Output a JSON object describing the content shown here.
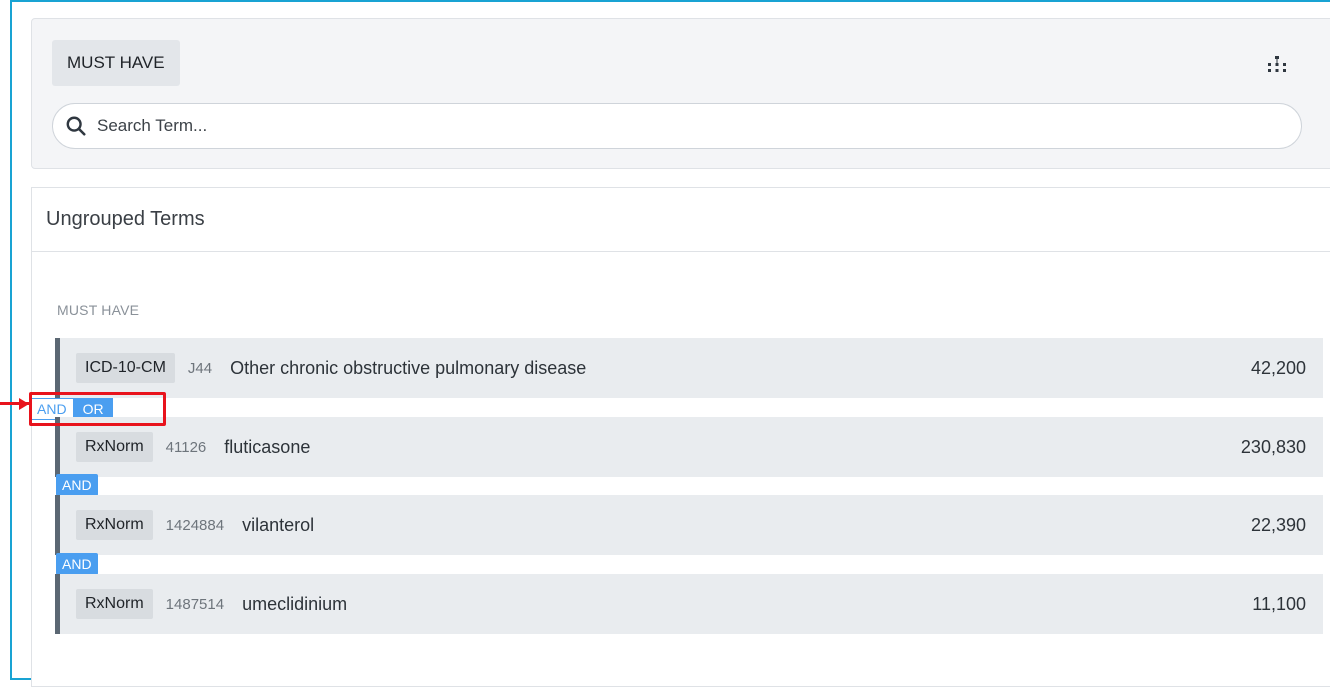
{
  "search_panel": {
    "must_have_label": "MUST HAVE",
    "search_placeholder": "Search Term..."
  },
  "terms_panel": {
    "header": "Ungrouped Terms",
    "section_label": "MUST HAVE",
    "terms": [
      {
        "vocab": "ICD-10-CM",
        "code": "J44",
        "name": "Other chronic obstructive pulmonary disease",
        "count": "42,200"
      },
      {
        "vocab": "RxNorm",
        "code": "41126",
        "name": "fluticasone",
        "count": "230,830"
      },
      {
        "vocab": "RxNorm",
        "code": "1424884",
        "name": "vilanterol",
        "count": "22,390"
      },
      {
        "vocab": "RxNorm",
        "code": "1487514",
        "name": "umeclidinium",
        "count": "11,100"
      }
    ],
    "operators": {
      "toggle_and": "AND",
      "toggle_or": "OR",
      "and_2": "AND",
      "and_3": "AND"
    }
  },
  "colors": {
    "accent": "#4a9ef0",
    "highlight": "#e8131c",
    "frame": "#19a3d3"
  },
  "icons": [
    "tree-hierarchy-icon",
    "search-icon"
  ]
}
